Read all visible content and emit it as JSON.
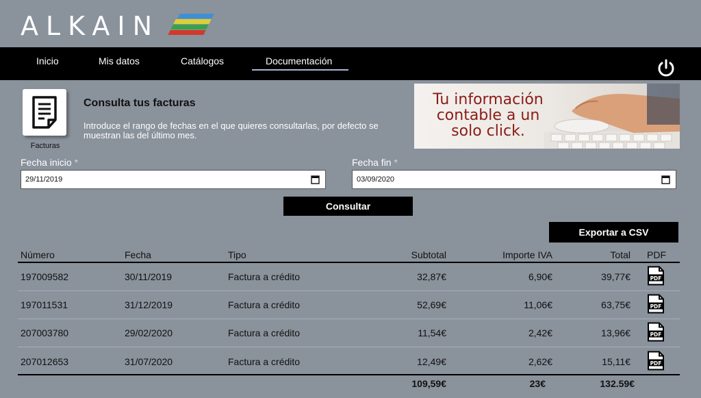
{
  "brand": {
    "name": "ALKAIN"
  },
  "nav": {
    "items": [
      {
        "label": "Inicio"
      },
      {
        "label": "Mis datos"
      },
      {
        "label": "Catálogos"
      },
      {
        "label": "Documentación"
      }
    ],
    "active": "Documentación",
    "power_icon": "power-icon"
  },
  "section": {
    "tile_label": "Facturas",
    "title": "Consulta tus facturas",
    "description": "Introduce el rango de fechas en el que quieres consultarlas, por defecto se muestran las del último mes."
  },
  "banner": {
    "text": "Tu información contable a un solo click."
  },
  "filters": {
    "start": {
      "label": "Fecha inicio",
      "required_mark": "*",
      "value": "29/11/2019"
    },
    "end": {
      "label": "Fecha fin",
      "required_mark": "*",
      "value": "03/09/2020"
    },
    "submit_label": "Consultar",
    "export_label": "Exportar a CSV"
  },
  "table": {
    "headers": [
      "Número",
      "Fecha",
      "Tipo",
      "Subtotal",
      "Importe IVA",
      "Total",
      "PDF"
    ],
    "rows": [
      {
        "numero": "197009582",
        "fecha": "30/11/2019",
        "tipo": "Factura a crédito",
        "subtotal": "32,87€",
        "iva": "6,90€",
        "total": "39,77€"
      },
      {
        "numero": "197011531",
        "fecha": "31/12/2019",
        "tipo": "Factura a crédito",
        "subtotal": "52,69€",
        "iva": "11,06€",
        "total": "63,75€"
      },
      {
        "numero": "207003780",
        "fecha": "29/02/2020",
        "tipo": "Factura a crédito",
        "subtotal": "11,54€",
        "iva": "2,42€",
        "total": "13,96€"
      },
      {
        "numero": "207012653",
        "fecha": "31/07/2020",
        "tipo": "Factura a crédito",
        "subtotal": "12,49€",
        "iva": "2,62€",
        "total": "15,11€"
      }
    ],
    "totals": {
      "subtotal": "109,59€",
      "iva": "23€",
      "total": "132.59€"
    }
  },
  "colors": {
    "background": "#8a929c",
    "navbar": "#000000",
    "banner_text": "#8a1c18"
  }
}
